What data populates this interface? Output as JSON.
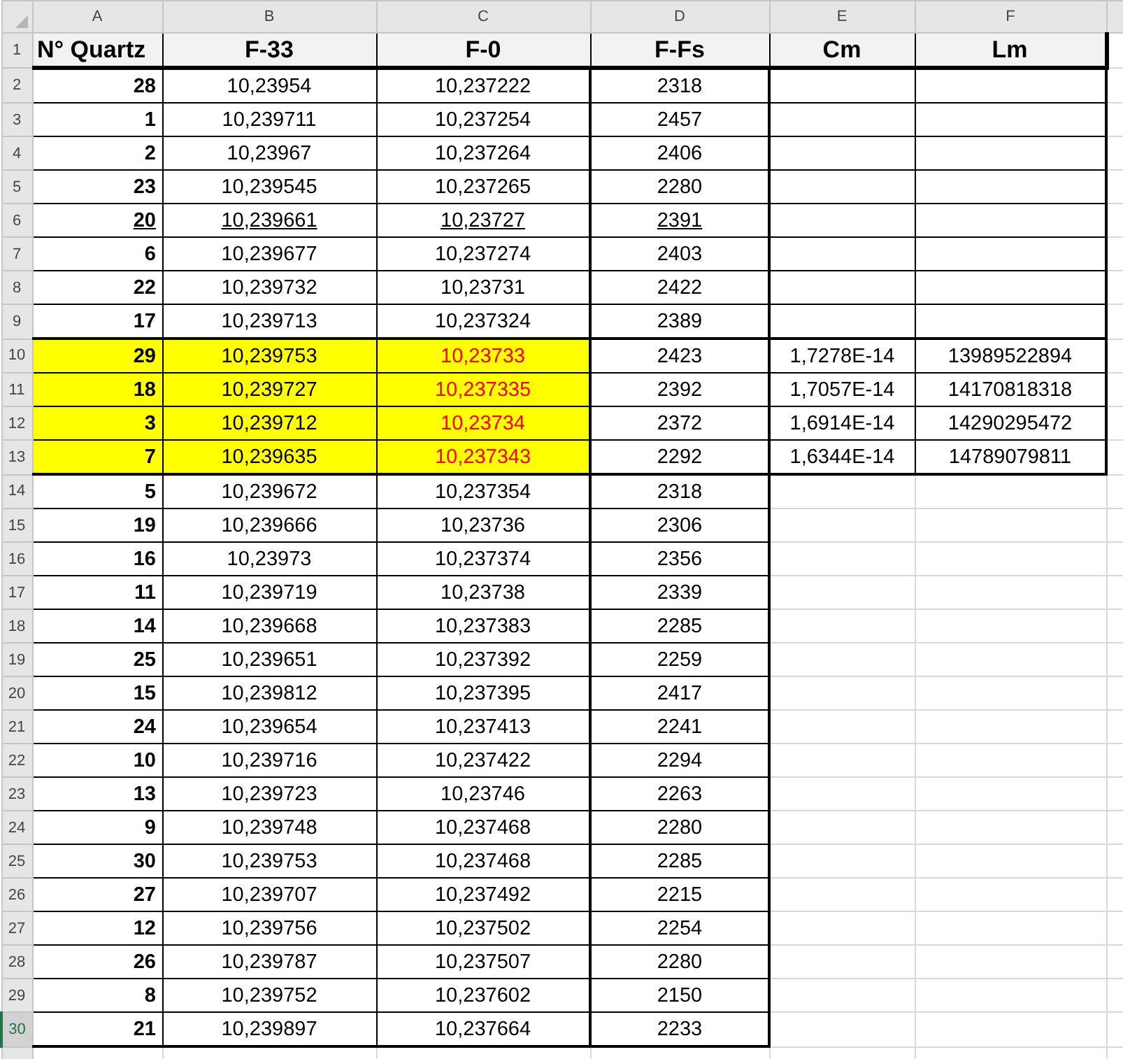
{
  "columns": [
    "A",
    "B",
    "C",
    "D",
    "E",
    "F"
  ],
  "header": {
    "num": "1",
    "labels": [
      "N° Quartz",
      "F-33",
      "F-0",
      "F-Fs",
      "Cm",
      "Lm"
    ]
  },
  "rows": [
    {
      "num": "2",
      "quartz": "28",
      "f33": "10,23954",
      "f0": "10,237222",
      "ffs": "2318",
      "highlighted": false,
      "underlined": false,
      "selected": false
    },
    {
      "num": "3",
      "quartz": "1",
      "f33": "10,239711",
      "f0": "10,237254",
      "ffs": "2457",
      "highlighted": false,
      "underlined": false,
      "selected": false
    },
    {
      "num": "4",
      "quartz": "2",
      "f33": "10,23967",
      "f0": "10,237264",
      "ffs": "2406",
      "highlighted": false,
      "underlined": false,
      "selected": false
    },
    {
      "num": "5",
      "quartz": "23",
      "f33": "10,239545",
      "f0": "10,237265",
      "ffs": "2280",
      "highlighted": false,
      "underlined": false,
      "selected": false
    },
    {
      "num": "6",
      "quartz": "20",
      "f33": "10,239661",
      "f0": "10,23727",
      "ffs": "2391",
      "highlighted": false,
      "underlined": true,
      "selected": false
    },
    {
      "num": "7",
      "quartz": "6",
      "f33": "10,239677",
      "f0": "10,237274",
      "ffs": "2403",
      "highlighted": false,
      "underlined": false,
      "selected": false
    },
    {
      "num": "8",
      "quartz": "22",
      "f33": "10,239732",
      "f0": "10,23731",
      "ffs": "2422",
      "highlighted": false,
      "underlined": false,
      "selected": false
    },
    {
      "num": "9",
      "quartz": "17",
      "f33": "10,239713",
      "f0": "10,237324",
      "ffs": "2389",
      "highlighted": false,
      "underlined": false,
      "selected": false
    },
    {
      "num": "10",
      "quartz": "29",
      "f33": "10,239753",
      "f0": "10,23733",
      "ffs": "2423",
      "cm": "1,7278E-14",
      "lm": "13989522894",
      "highlighted": true,
      "underlined": false,
      "selected": false
    },
    {
      "num": "11",
      "quartz": "18",
      "f33": "10,239727",
      "f0": "10,237335",
      "ffs": "2392",
      "cm": "1,7057E-14",
      "lm": "14170818318",
      "highlighted": true,
      "underlined": false,
      "selected": false
    },
    {
      "num": "12",
      "quartz": "3",
      "f33": "10,239712",
      "f0": "10,23734",
      "ffs": "2372",
      "cm": "1,6914E-14",
      "lm": "14290295472",
      "highlighted": true,
      "underlined": false,
      "selected": false
    },
    {
      "num": "13",
      "quartz": "7",
      "f33": "10,239635",
      "f0": "10,237343",
      "ffs": "2292",
      "cm": "1,6344E-14",
      "lm": "14789079811",
      "highlighted": true,
      "underlined": false,
      "selected": false
    },
    {
      "num": "14",
      "quartz": "5",
      "f33": "10,239672",
      "f0": "10,237354",
      "ffs": "2318",
      "highlighted": false,
      "underlined": false,
      "selected": false
    },
    {
      "num": "15",
      "quartz": "19",
      "f33": "10,239666",
      "f0": "10,23736",
      "ffs": "2306",
      "highlighted": false,
      "underlined": false,
      "selected": false
    },
    {
      "num": "16",
      "quartz": "16",
      "f33": "10,23973",
      "f0": "10,237374",
      "ffs": "2356",
      "highlighted": false,
      "underlined": false,
      "selected": false
    },
    {
      "num": "17",
      "quartz": "11",
      "f33": "10,239719",
      "f0": "10,23738",
      "ffs": "2339",
      "highlighted": false,
      "underlined": false,
      "selected": false
    },
    {
      "num": "18",
      "quartz": "14",
      "f33": "10,239668",
      "f0": "10,237383",
      "ffs": "2285",
      "highlighted": false,
      "underlined": false,
      "selected": false
    },
    {
      "num": "19",
      "quartz": "25",
      "f33": "10,239651",
      "f0": "10,237392",
      "ffs": "2259",
      "highlighted": false,
      "underlined": false,
      "selected": false
    },
    {
      "num": "20",
      "quartz": "15",
      "f33": "10,239812",
      "f0": "10,237395",
      "ffs": "2417",
      "highlighted": false,
      "underlined": false,
      "selected": false
    },
    {
      "num": "21",
      "quartz": "24",
      "f33": "10,239654",
      "f0": "10,237413",
      "ffs": "2241",
      "highlighted": false,
      "underlined": false,
      "selected": false
    },
    {
      "num": "22",
      "quartz": "10",
      "f33": "10,239716",
      "f0": "10,237422",
      "ffs": "2294",
      "highlighted": false,
      "underlined": false,
      "selected": false
    },
    {
      "num": "23",
      "quartz": "13",
      "f33": "10,239723",
      "f0": "10,23746",
      "ffs": "2263",
      "highlighted": false,
      "underlined": false,
      "selected": false
    },
    {
      "num": "24",
      "quartz": "9",
      "f33": "10,239748",
      "f0": "10,237468",
      "ffs": "2280",
      "highlighted": false,
      "underlined": false,
      "selected": false
    },
    {
      "num": "25",
      "quartz": "30",
      "f33": "10,239753",
      "f0": "10,237468",
      "ffs": "2285",
      "highlighted": false,
      "underlined": false,
      "selected": false
    },
    {
      "num": "26",
      "quartz": "27",
      "f33": "10,239707",
      "f0": "10,237492",
      "ffs": "2215",
      "highlighted": false,
      "underlined": false,
      "selected": false
    },
    {
      "num": "27",
      "quartz": "12",
      "f33": "10,239756",
      "f0": "10,237502",
      "ffs": "2254",
      "highlighted": false,
      "underlined": false,
      "selected": false
    },
    {
      "num": "28",
      "quartz": "26",
      "f33": "10,239787",
      "f0": "10,237507",
      "ffs": "2280",
      "highlighted": false,
      "underlined": false,
      "selected": false
    },
    {
      "num": "29",
      "quartz": "8",
      "f33": "10,239752",
      "f0": "10,237602",
      "ffs": "2150",
      "highlighted": false,
      "underlined": false,
      "selected": false
    },
    {
      "num": "30",
      "quartz": "21",
      "f33": "10,239897",
      "f0": "10,237664",
      "ffs": "2233",
      "highlighted": false,
      "underlined": false,
      "selected": true
    }
  ]
}
